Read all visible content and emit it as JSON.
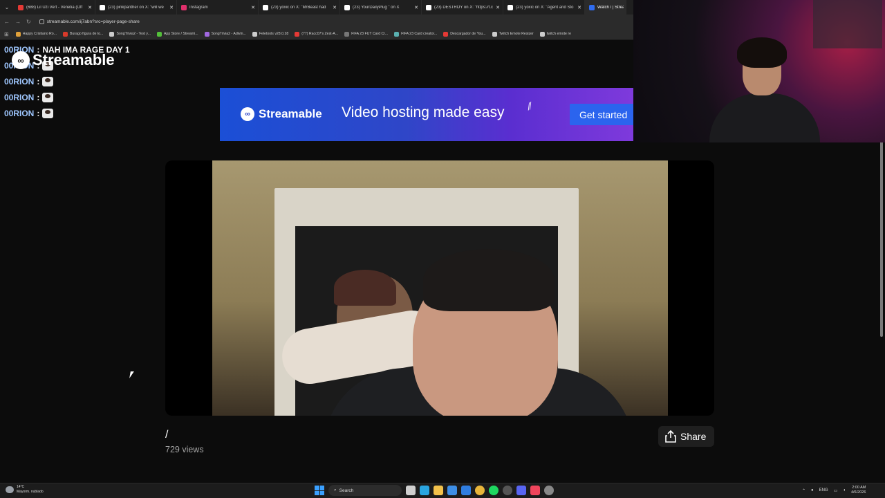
{
  "browser": {
    "tabs": [
      {
        "title": "(688) Lil Uzi Vert - Venetia (Off",
        "favicon": "youtube-icon",
        "color": "#e53935"
      },
      {
        "title": "(23) pinkpanther on X: \"will we",
        "favicon": "x-icon",
        "color": "#ffffff"
      },
      {
        "title": "Instagram",
        "favicon": "instagram-icon",
        "color": "#e1306c"
      },
      {
        "title": "(23) yoxic on X: \"MrBeast had",
        "favicon": "x-icon",
        "color": "#ffffff"
      },
      {
        "title": "(23) YourDailyPlug \" on X",
        "favicon": "x-icon",
        "color": "#ffffff"
      },
      {
        "title": "(23) DESTROY on X: \"https://t.c",
        "favicon": "x-icon",
        "color": "#ffffff"
      },
      {
        "title": "(23) yoxic on X: \"Agent and Sto",
        "favicon": "x-icon",
        "color": "#ffffff"
      },
      {
        "title": "Watch / | Streama",
        "favicon": "streamable-icon",
        "color": "#2f6cf0"
      }
    ],
    "url": "streamable.com/ij7abn?src=player-page-share",
    "bookmarks": [
      {
        "label": "Happy Cristiano Ro...",
        "color": "#e0a13a"
      },
      {
        "label": "Burago figura de to...",
        "color": "#d83a2b"
      },
      {
        "label": "SongTrivia2 - Test y...",
        "color": "#cccccc"
      },
      {
        "label": "App Store / Streami...",
        "color": "#53c03a"
      },
      {
        "label": "SongTrivia2 - Adivin...",
        "color": "#a168e0"
      },
      {
        "label": "Feletools v28.0.28",
        "color": "#cccccc"
      },
      {
        "label": "(77) Racc07's Zest-A...",
        "color": "#e53935"
      },
      {
        "label": "FIFA 23 FUT Card Cr...",
        "color": "#777777"
      },
      {
        "label": "FIFA 23 Card creator...",
        "color": "#5ab0b0"
      },
      {
        "label": "Descargador de You...",
        "color": "#e53935"
      },
      {
        "label": "Twitch Emote Resizer",
        "color": "#cccccc"
      },
      {
        "label": "twitch emote re",
        "color": "#cccccc"
      }
    ]
  },
  "overlay": {
    "logo_text": "Streamable",
    "chat": [
      {
        "user": "00RION",
        "message": "NAH IMA RAGE DAY 1",
        "emote": false
      },
      {
        "user": "00RION",
        "message": "",
        "emote": true
      },
      {
        "user": "00RION",
        "message": "",
        "emote": true
      },
      {
        "user": "00RION",
        "message": "",
        "emote": true
      },
      {
        "user": "00RION",
        "message": "",
        "emote": true
      }
    ]
  },
  "ad": {
    "brand": "Streamable",
    "tagline": "Video hosting made easy",
    "cta": "Get started"
  },
  "video": {
    "title": "/",
    "views": "729 views",
    "share_label": "Share"
  },
  "taskbar": {
    "weather_temp": "14°C",
    "weather_desc": "Mayorm. nublado",
    "search_label": "Search",
    "lang": "ENG",
    "time": "2:00 AM",
    "date": "4/6/2026"
  }
}
